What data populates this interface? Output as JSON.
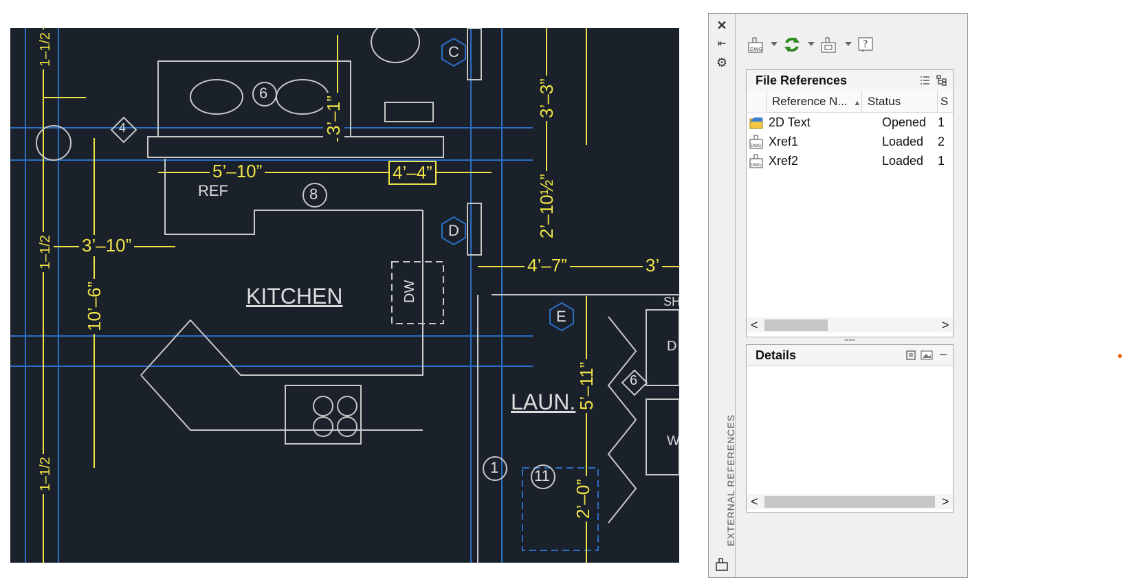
{
  "drawing": {
    "room_labels": [
      "KITCHEN",
      "LAUN.",
      "REF",
      "DW"
    ],
    "dimensions": [
      "5’–10”",
      "4’–4”",
      "3’–10”",
      "4’–7”",
      "3’",
      "3’–1”",
      "3’–3”",
      "2’–10½”",
      "10’–6”",
      "5’–11”",
      "2’–0”",
      "1–1/2",
      "1–1/2",
      "1–1/2"
    ],
    "tags": [
      "4",
      "6",
      "8",
      "6",
      "1",
      "11",
      "C",
      "D",
      "E",
      "D",
      "W",
      "SH"
    ]
  },
  "palette": {
    "title": "EXTERNAL REFERENCES",
    "strip": {
      "close_icon": "close-icon",
      "autohide_icon": "autohide-icon",
      "properties_icon": "properties-icon",
      "palette_icon": "xref-palette-icon"
    },
    "toolbar": {
      "attach_icon": "attach-dwg-icon",
      "refresh_icon": "refresh-icon",
      "change_path_icon": "change-path-icon",
      "help_icon": "help-icon"
    },
    "file_references": {
      "title": "File References",
      "columns": [
        "Reference N...",
        "Status",
        "S"
      ],
      "rows": [
        {
          "name": "2D Text",
          "status": "Opened",
          "size": "1"
        },
        {
          "name": "Xref1",
          "status": "Loaded",
          "size": "2"
        },
        {
          "name": "Xref2",
          "status": "Loaded",
          "size": "1"
        }
      ],
      "scroll_left": "<",
      "scroll_right": ">"
    },
    "details": {
      "title": "Details",
      "collapse": "–",
      "scroll_left": "<",
      "scroll_right": ">"
    }
  },
  "colors": {
    "drawing_bg": "#1b212b",
    "dimension": "#f0e447",
    "wall": "#dcdcdc",
    "blue_line": "#2b6fc4",
    "accent_dot": "#e86a10"
  }
}
